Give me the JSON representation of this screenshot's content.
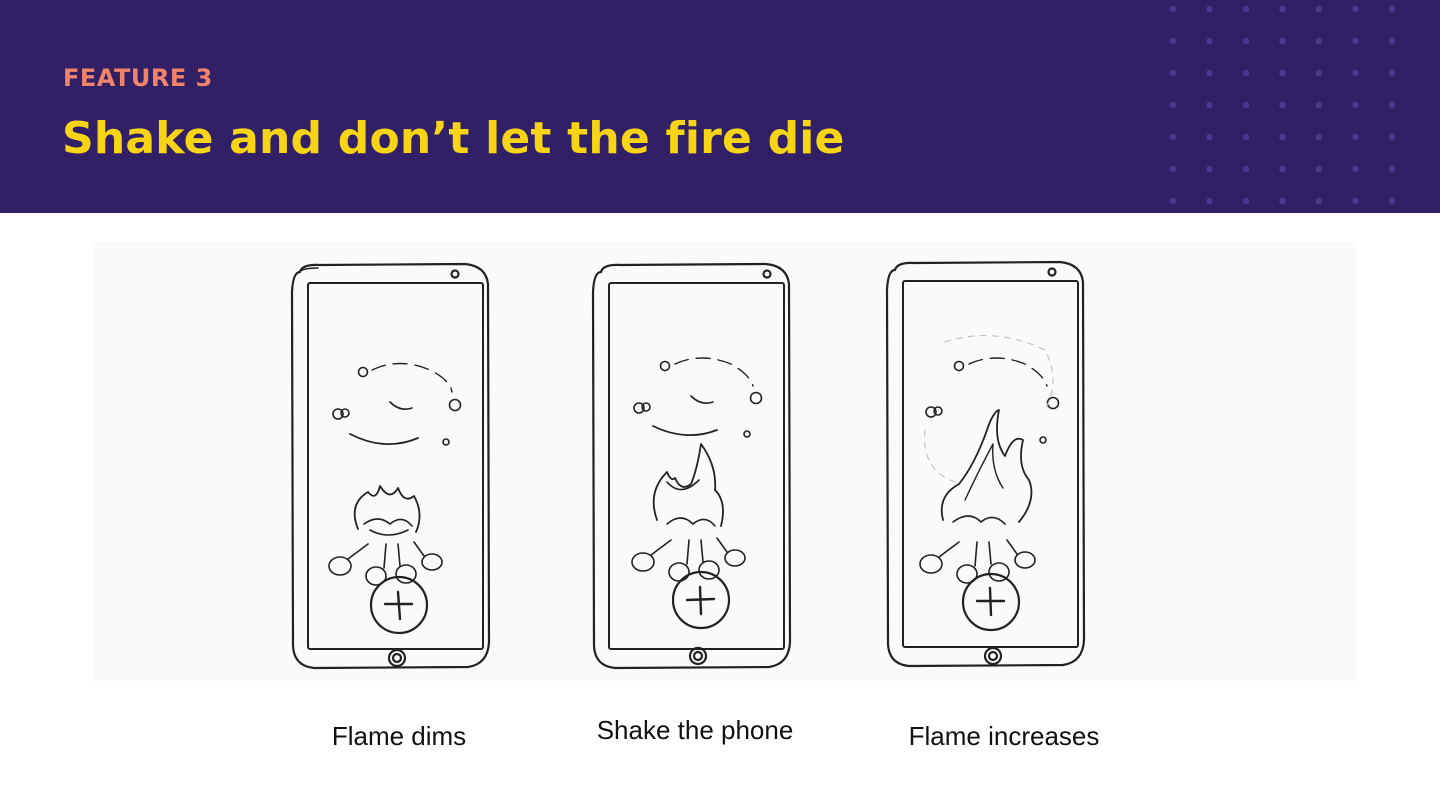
{
  "header": {
    "eyebrow": "FEATURE 3",
    "title": "Shake and don’t let the fire die"
  },
  "frames": [
    {
      "caption": "Flame dims",
      "flame_level": "dim"
    },
    {
      "caption": "Shake the phone",
      "flame_level": "shake"
    },
    {
      "caption": "Flame increases",
      "flame_level": "high"
    }
  ],
  "colors": {
    "header_bg": "#312066",
    "eyebrow": "#f0836a",
    "title": "#f7d516",
    "dots": "#4a3a8e",
    "sketch_ink": "#222222"
  },
  "icons": [
    "plus-icon",
    "home-button-icon",
    "campfire-icon"
  ]
}
